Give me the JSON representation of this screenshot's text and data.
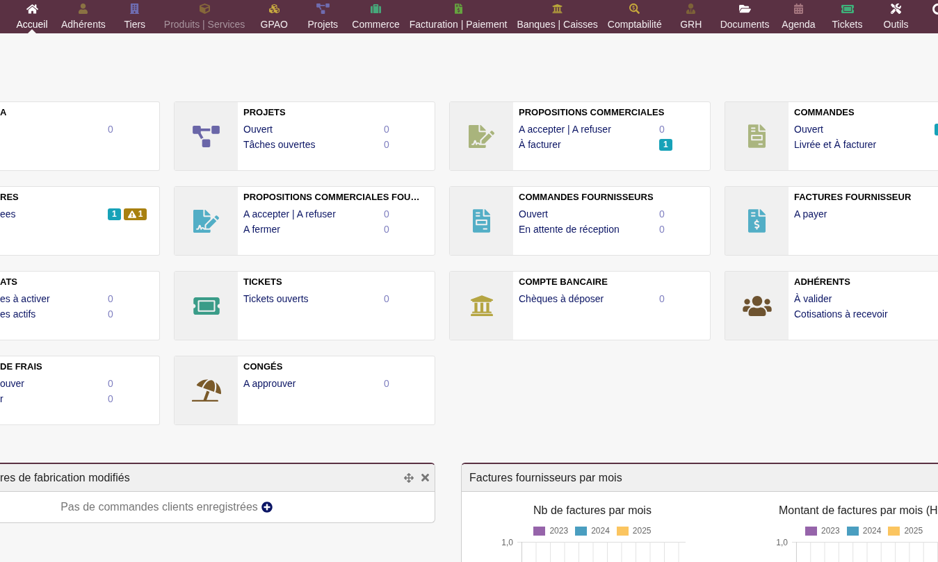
{
  "nav": {
    "items": [
      {
        "label": "Accueil",
        "color": "#ffffff",
        "selected": true,
        "disabled": false
      },
      {
        "label": "Adhérents",
        "color": "#8a7243",
        "selected": false,
        "disabled": false
      },
      {
        "label": "Tiers",
        "color": "#6f6cb0",
        "selected": false,
        "disabled": false
      },
      {
        "label": "Produits | Services",
        "color": "#86683a",
        "selected": false,
        "disabled": true
      },
      {
        "label": "GPAO",
        "color": "#c8a940",
        "selected": false,
        "disabled": false
      },
      {
        "label": "Projets",
        "color": "#6f6cb0",
        "selected": false,
        "disabled": false
      },
      {
        "label": "Commerce",
        "color": "#47a77a",
        "selected": false,
        "disabled": false
      },
      {
        "label": "Facturation | Paiement",
        "color": "#65a33f",
        "selected": false,
        "disabled": false
      },
      {
        "label": "Banques | Caisses",
        "color": "#b9a63a",
        "selected": false,
        "disabled": false
      },
      {
        "label": "Comptabilité",
        "color": "#c6a83c",
        "selected": false,
        "disabled": false
      },
      {
        "label": "GRH",
        "color": "#7d6238",
        "selected": false,
        "disabled": false
      },
      {
        "label": "Documents",
        "color": "#ffffff",
        "selected": false,
        "disabled": false
      },
      {
        "label": "Agenda",
        "color": "#a5767f",
        "selected": false,
        "disabled": false
      },
      {
        "label": "Tickets",
        "color": "#3fae79",
        "selected": false,
        "disabled": false
      },
      {
        "label": "Outils",
        "color": "#ffffff",
        "selected": false,
        "disabled": false
      }
    ]
  },
  "boxes": [
    {
      "title": "A",
      "rows": [
        {
          "value": "0"
        }
      ]
    },
    {
      "title": "PROJETS",
      "color": "#6a66a8",
      "rows": [
        {
          "label": "Ouvert",
          "value": "0"
        },
        {
          "label": "Tâches ouvertes",
          "value": "0"
        }
      ]
    },
    {
      "title": "PROPOSITIONS COMMERCIALES",
      "color": "#a9b47c",
      "rows": [
        {
          "label": "A accepter | A refuser",
          "value": "0"
        },
        {
          "label": "À facturer",
          "badges": [
            {
              "kind": "count",
              "text": "1"
            }
          ]
        }
      ]
    },
    {
      "title": "COMMANDES",
      "color": "#aab57f",
      "rows": [
        {
          "label": "Ouvert",
          "badge_cut": true
        },
        {
          "label": "Livrée et À facturer"
        }
      ]
    },
    {
      "title": "RES",
      "rows": [
        {
          "label": "ees",
          "badges": [
            {
              "kind": "count",
              "text": "1"
            },
            {
              "kind": "warning",
              "text": "1"
            }
          ]
        }
      ]
    },
    {
      "title": "PROPOSITIONS COMMERCIALES FOU…",
      "color": "#52aec6",
      "rows": [
        {
          "label": "A accepter | A refuser",
          "value": "0"
        },
        {
          "label": "A fermer",
          "value": "0"
        }
      ]
    },
    {
      "title": "COMMANDES FOURNISSEURS",
      "color": "#52aec6",
      "rows": [
        {
          "label": "Ouvert",
          "value": "0"
        },
        {
          "label": "En attente de réception",
          "value": "0"
        }
      ]
    },
    {
      "title": "FACTURES FOURNISSEUR",
      "color": "#52aec6",
      "rows": [
        {
          "label": "A payer"
        }
      ]
    },
    {
      "title": "ATS",
      "rows": [
        {
          "label": "es à activer",
          "value": "0"
        },
        {
          "label": "es actifs",
          "value": "0"
        }
      ]
    },
    {
      "title": "TICKETS",
      "color": "#3a9c88",
      "rows": [
        {
          "label": "Tickets ouverts",
          "value": "0"
        }
      ]
    },
    {
      "title": "COMPTE BANCAIRE",
      "color": "#b5a542",
      "rows": [
        {
          "label": "Chèques à déposer",
          "value": "0"
        }
      ]
    },
    {
      "title": "ADHÉRENTS",
      "color": "#6e5330",
      "rows": [
        {
          "label": "À valider"
        },
        {
          "label": "Cotisations à recevoir"
        }
      ]
    },
    {
      "title": "DE FRAIS",
      "rows": [
        {
          "label": "ouver",
          "value": "0"
        },
        {
          "label": "r",
          "value": "0"
        }
      ]
    },
    {
      "title": "CONGÉS",
      "color": "#7a5a2a",
      "rows": [
        {
          "label": "A approuver",
          "value": "0"
        }
      ]
    }
  ],
  "widgets": [
    {
      "kind": "message",
      "title": "res de fabrication modifiés",
      "message": "Pas de commandes clients enregistrées"
    },
    {
      "kind": "charts",
      "title": "Factures fournisseurs par mois",
      "charts": [
        {
          "title": "Nb de factures par mois",
          "legend": [
            {
              "label": "2023",
              "color": "#9664aa"
            },
            {
              "label": "2024",
              "color": "#4a9ec0"
            },
            {
              "label": "2025",
              "color": "#fbc560"
            }
          ],
          "y_tick_labels": [
            "1,0"
          ]
        },
        {
          "title": "Montant de factures par mois (H",
          "legend": [
            {
              "label": "2023",
              "color": "#9664aa"
            },
            {
              "label": "2024",
              "color": "#4a9ec0"
            },
            {
              "label": "2025",
              "color": "#fbc560"
            }
          ],
          "y_tick_labels": [
            "1,0"
          ]
        }
      ]
    }
  ]
}
